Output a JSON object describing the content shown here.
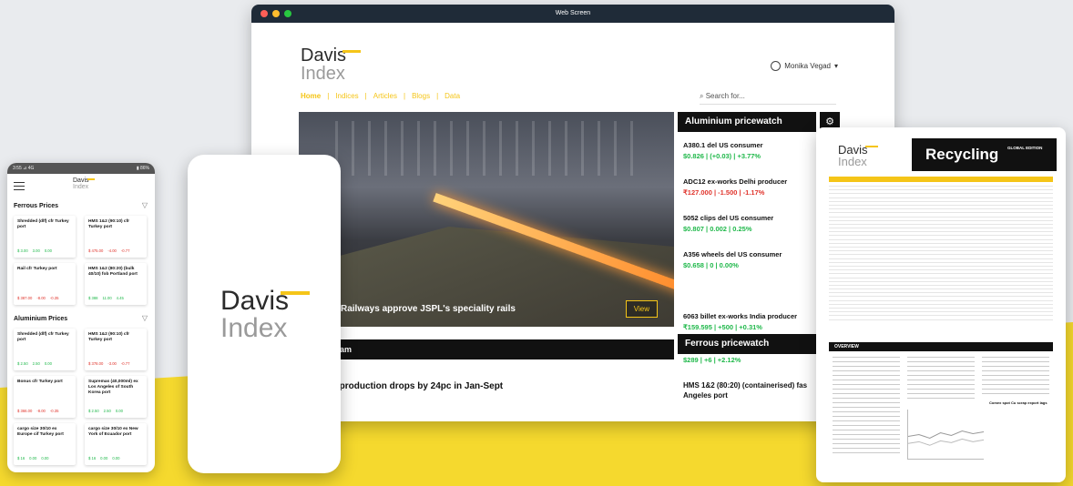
{
  "brand": {
    "name_line1": "Davis",
    "name_line2": "Index",
    "accent": "#f5c518"
  },
  "window": {
    "title": "Web Screen"
  },
  "user": {
    "name": "Monika Vegad",
    "caret": "▾"
  },
  "nav": {
    "items": [
      "Home",
      "Indices",
      "Articles",
      "Blogs",
      "Data"
    ],
    "separator": "|"
  },
  "search": {
    "placeholder": "Search for..."
  },
  "hero": {
    "caption": "Railways approve JSPL's speciality rails",
    "view_label": "View"
  },
  "aluminium_watch": {
    "title": "Aluminium pricewatch",
    "items": [
      {
        "name": "A380.1 del US consumer",
        "value": "$0.826 | (+0.03) | +3.77%",
        "trend": "up"
      },
      {
        "name": "ADC12 ex-works Delhi producer",
        "value": "₹127.000 | -1.500 | -1.17%",
        "trend": "down"
      },
      {
        "name": "5052 clips del US consumer",
        "value": "$0.807 | 0.002 | 0.25%",
        "trend": "up"
      },
      {
        "name": "A356 wheels del US consumer",
        "value": "$0.658 | 0 | 0.00%",
        "trend": "up"
      },
      {
        "name": "6063 billet ex-works India producer",
        "value": "₹159.595 | +500 | +0.31%",
        "trend": "up"
      }
    ]
  },
  "team": {
    "title": "eam"
  },
  "story": {
    "headline": "r production drops by 24pc in Jan-Sept"
  },
  "ferrous_watch": {
    "title": "Ferrous pricewatch",
    "top_value": "$289 | +6 | +2.12%",
    "name": "HMS 1&2 (80:20) (containerised) fas Angeles port"
  },
  "mobile": {
    "status_left": "3:55 ⊿ 4G",
    "status_right": "▮ 86%",
    "ferrous_section": "Ferrous Prices",
    "aluminium_section": "Aluminium Prices",
    "filter_icon": "▽",
    "ferrous_cards": [
      {
        "name": "Shredded (dlf) cfr Turkey port",
        "v1": "$ 3.00",
        "v2": "3.00",
        "v3": "0.00",
        "trend": "up"
      },
      {
        "name": "HMS 1&2 (90:10) cfr Turkey port",
        "v1": "$ 475.00",
        "v2": "-4.00",
        "v3": "-0.77",
        "trend": "down"
      },
      {
        "name": "Rail cfr Turkey port",
        "v1": "$ 387.00",
        "v2": "-8.00",
        "v3": "-0.35",
        "trend": "down"
      },
      {
        "name": "HMS 1&2 (80:20) (bulk 40/10) fob Portland port",
        "v1": "$ 388",
        "v2": "11.00",
        "v3": "4.45",
        "trend": "up"
      }
    ],
    "aluminium_cards": [
      {
        "name": "Shredded (dlf) cfr Turkey port",
        "v1": "$ 2.50",
        "v2": "2.50",
        "v3": "0.00",
        "trend": "up"
      },
      {
        "name": "HMS 1&2 (90:10) cfr Turkey port",
        "v1": "$ 378.00",
        "v2": "-3.00",
        "v3": "-0.77",
        "trend": "down"
      },
      {
        "name": "Bonus cfr Turkey port",
        "v1": "$ 366.00",
        "v2": "-8.00",
        "v3": "-0.35",
        "trend": "down"
      },
      {
        "name": "Supremas (40,000ml) ex Los Angeles of South Korea port",
        "v1": "$ 2.50",
        "v2": "2.50",
        "v3": "0.00",
        "trend": "up"
      },
      {
        "name": "cargo size 30/10 ex Europe cif Turkey port",
        "v1": "$ 16",
        "v2": "0.00",
        "v3": "0.00",
        "trend": "up"
      },
      {
        "name": "cargo size 30/10 ex New York of Ecuador port",
        "v1": "$ 16",
        "v2": "0.00",
        "v3": "0.00",
        "trend": "up"
      }
    ]
  },
  "report": {
    "title": "Recycling",
    "edition": "GLOBAL EDITION",
    "overview_label": "OVERVIEW",
    "side_heading": "Comex spot Cu scrap export lags"
  },
  "colors": {
    "up": "#1fb84a",
    "down": "#e0342c",
    "dark": "#111111",
    "yellow": "#f5d92e"
  }
}
